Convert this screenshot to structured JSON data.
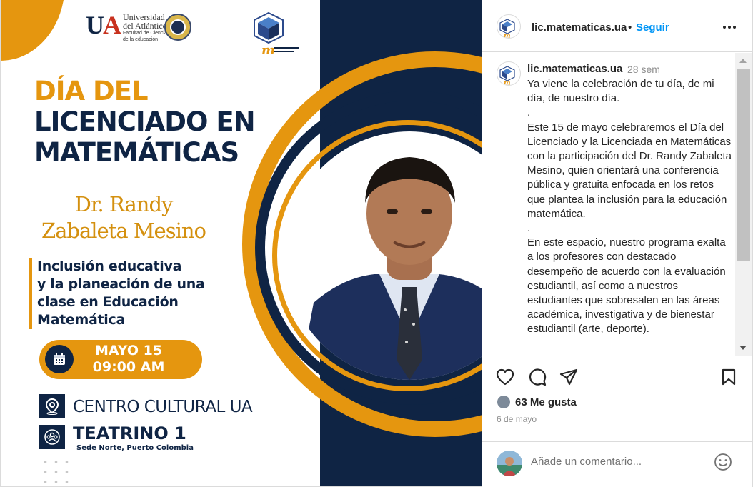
{
  "poster": {
    "university": {
      "mark": "UA",
      "name_line1": "Universidad",
      "name_line2": "del Atlántico",
      "faculty_line1": "Facultad de Ciencias",
      "faculty_line2": "de la educación"
    },
    "title": {
      "line1": "DÍA DEL",
      "line2": "LICENCIADO EN",
      "line3": "MATEMÁTICAS"
    },
    "speaker": {
      "line1": "Dr. Randy",
      "line2": "Zabaleta Mesino"
    },
    "topic": {
      "line1": "Inclusión educativa",
      "line2": "y la planeación de una",
      "line3": "clase en Educación",
      "line4": "Matemática"
    },
    "date": {
      "day": "MAYO 15",
      "time": "09:00 AM"
    },
    "venue": {
      "place": "CENTRO CULTURAL UA",
      "room": "TEATRINO 1",
      "site": "Sede Norte, Puerto Colombia"
    },
    "icons": [
      "calendar-icon",
      "map-pin-icon",
      "people-icon"
    ],
    "colors": {
      "navy": "#0f2444",
      "orange": "#e5960f"
    }
  },
  "header": {
    "username": "lic.matematicas.ua",
    "dot": "•",
    "follow_label": "Seguir"
  },
  "caption": {
    "username": "lic.matematicas.ua",
    "time": "28 sem",
    "paragraphs": [
      "Ya viene la celebración de tu día, de mi día, de nuestro día.",
      ".",
      "Este 15 de mayo celebraremos el Día del Licenciado y la Licenciada en Matemáticas con la participación del Dr. Randy Zabaleta Mesino, quien orientará una conferencia pública y gratuita enfocada en los retos que plantea la inclusión para la educación matemática.",
      ".",
      "En este espacio, nuestro programa exalta a los profesores con destacado desempeño de acuerdo con la evaluación estudiantil, así como a nuestros estudiantes que sobresalen en las áreas académica, investigativa y de bienestar estudiantil (arte, deporte)."
    ]
  },
  "actions": {
    "likes": "63 Me gusta",
    "date": "6 de mayo",
    "icons": [
      "heart-icon",
      "comment-icon",
      "send-icon",
      "bookmark-icon"
    ]
  },
  "comment_box": {
    "placeholder": "Añade un comentario...",
    "emoji_icon": "smiley-icon"
  },
  "colors": {
    "link": "#0095f6",
    "text": "#262626",
    "muted": "#8e8e8e",
    "border": "#dbdbdb"
  }
}
